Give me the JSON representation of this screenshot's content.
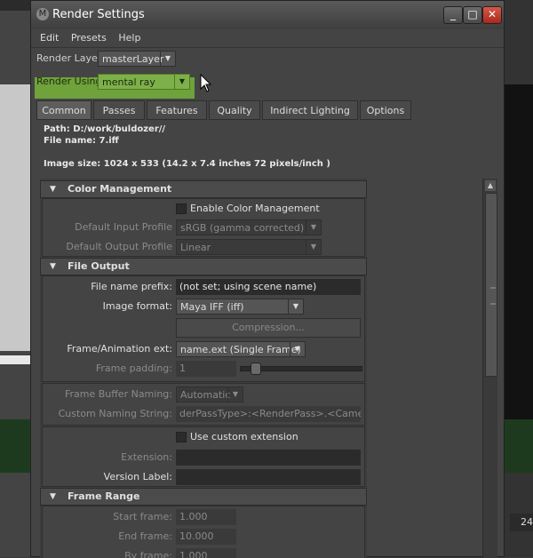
{
  "window": {
    "title": "Render Settings"
  },
  "menu": [
    "Edit",
    "Presets",
    "Help"
  ],
  "render_layer": {
    "label": "Render Layer",
    "value": "masterLayer"
  },
  "render_using": {
    "label": "Render Using",
    "value": "mental ray"
  },
  "tabs": [
    "Common",
    "Passes",
    "Features",
    "Quality",
    "Indirect Lighting",
    "Options"
  ],
  "info": {
    "path": "Path: D:/work/buldozer//",
    "file_name": "File name:  7.iff",
    "image_size": "Image size: 1024 x 533 (14.2 x 7.4 inches 72 pixels/inch )"
  },
  "color_management": {
    "title": "Color Management",
    "enable_label": "Enable Color Management",
    "input_profile_label": "Default Input Profile",
    "input_profile_value": "sRGB (gamma corrected)",
    "output_profile_label": "Default Output Profile",
    "output_profile_value": "Linear"
  },
  "file_output": {
    "title": "File Output",
    "prefix_label": "File name prefix:",
    "prefix_value": "(not set; using scene name)",
    "format_label": "Image format:",
    "format_value": "Maya IFF (iff)",
    "compression_label": "Compression...",
    "frame_ext_label": "Frame/Animation ext:",
    "frame_ext_value": "name.ext (Single Frame)",
    "padding_label": "Frame padding:",
    "padding_value": "1",
    "buffer_naming_label": "Frame Buffer Naming:",
    "buffer_naming_value": "Automatic",
    "custom_naming_label": "Custom Naming String:",
    "custom_naming_value": "derPassType>:<RenderPass>.<Camera>",
    "use_custom_ext_label": "Use custom extension",
    "extension_label": "Extension:",
    "extension_value": "",
    "version_label": "Version Label:",
    "version_value": ""
  },
  "frame_range": {
    "title": "Frame Range",
    "start_label": "Start frame:",
    "start_value": "1.000",
    "end_label": "End frame:",
    "end_value": "10.000",
    "by_label": "By frame:",
    "by_value": "1.000"
  },
  "background": {
    "counter": "24"
  }
}
